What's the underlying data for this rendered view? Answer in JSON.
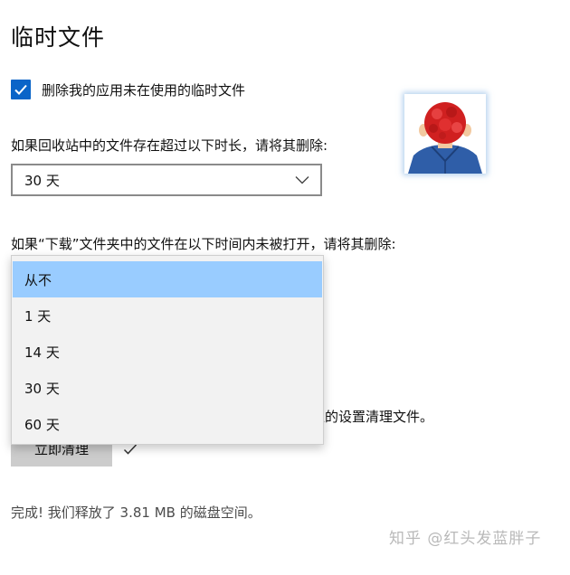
{
  "page": {
    "title": "临时文件"
  },
  "checkbox": {
    "label": "删除我的应用未在使用的临时文件",
    "checked": true
  },
  "recycle_bin": {
    "label": "如果回收站中的文件存在超过以下时长，请将其删除:",
    "selected_value": "30 天"
  },
  "downloads": {
    "label": "如果“下载”文件夹中的文件在以下时间内未被打开，请将其删除:",
    "options": [
      "从不",
      "1 天",
      "14 天",
      "30 天",
      "60 天"
    ],
    "selected_index": 0
  },
  "partial_text": "上的设置清理文件。",
  "clean_button": {
    "label": "立即清理"
  },
  "status": {
    "text": "完成! 我们释放了 3.81 MB 的磁盘空间。"
  },
  "watermark": {
    "text": "知乎 @红头发蓝胖子"
  },
  "colors": {
    "accent": "#0a64c8",
    "dropdown_highlight": "#99ccff",
    "button_bg": "#cccccc"
  },
  "icons": {
    "checkbox": "checkmark-icon",
    "select": "chevron-down-icon",
    "done": "checkmark-icon"
  }
}
